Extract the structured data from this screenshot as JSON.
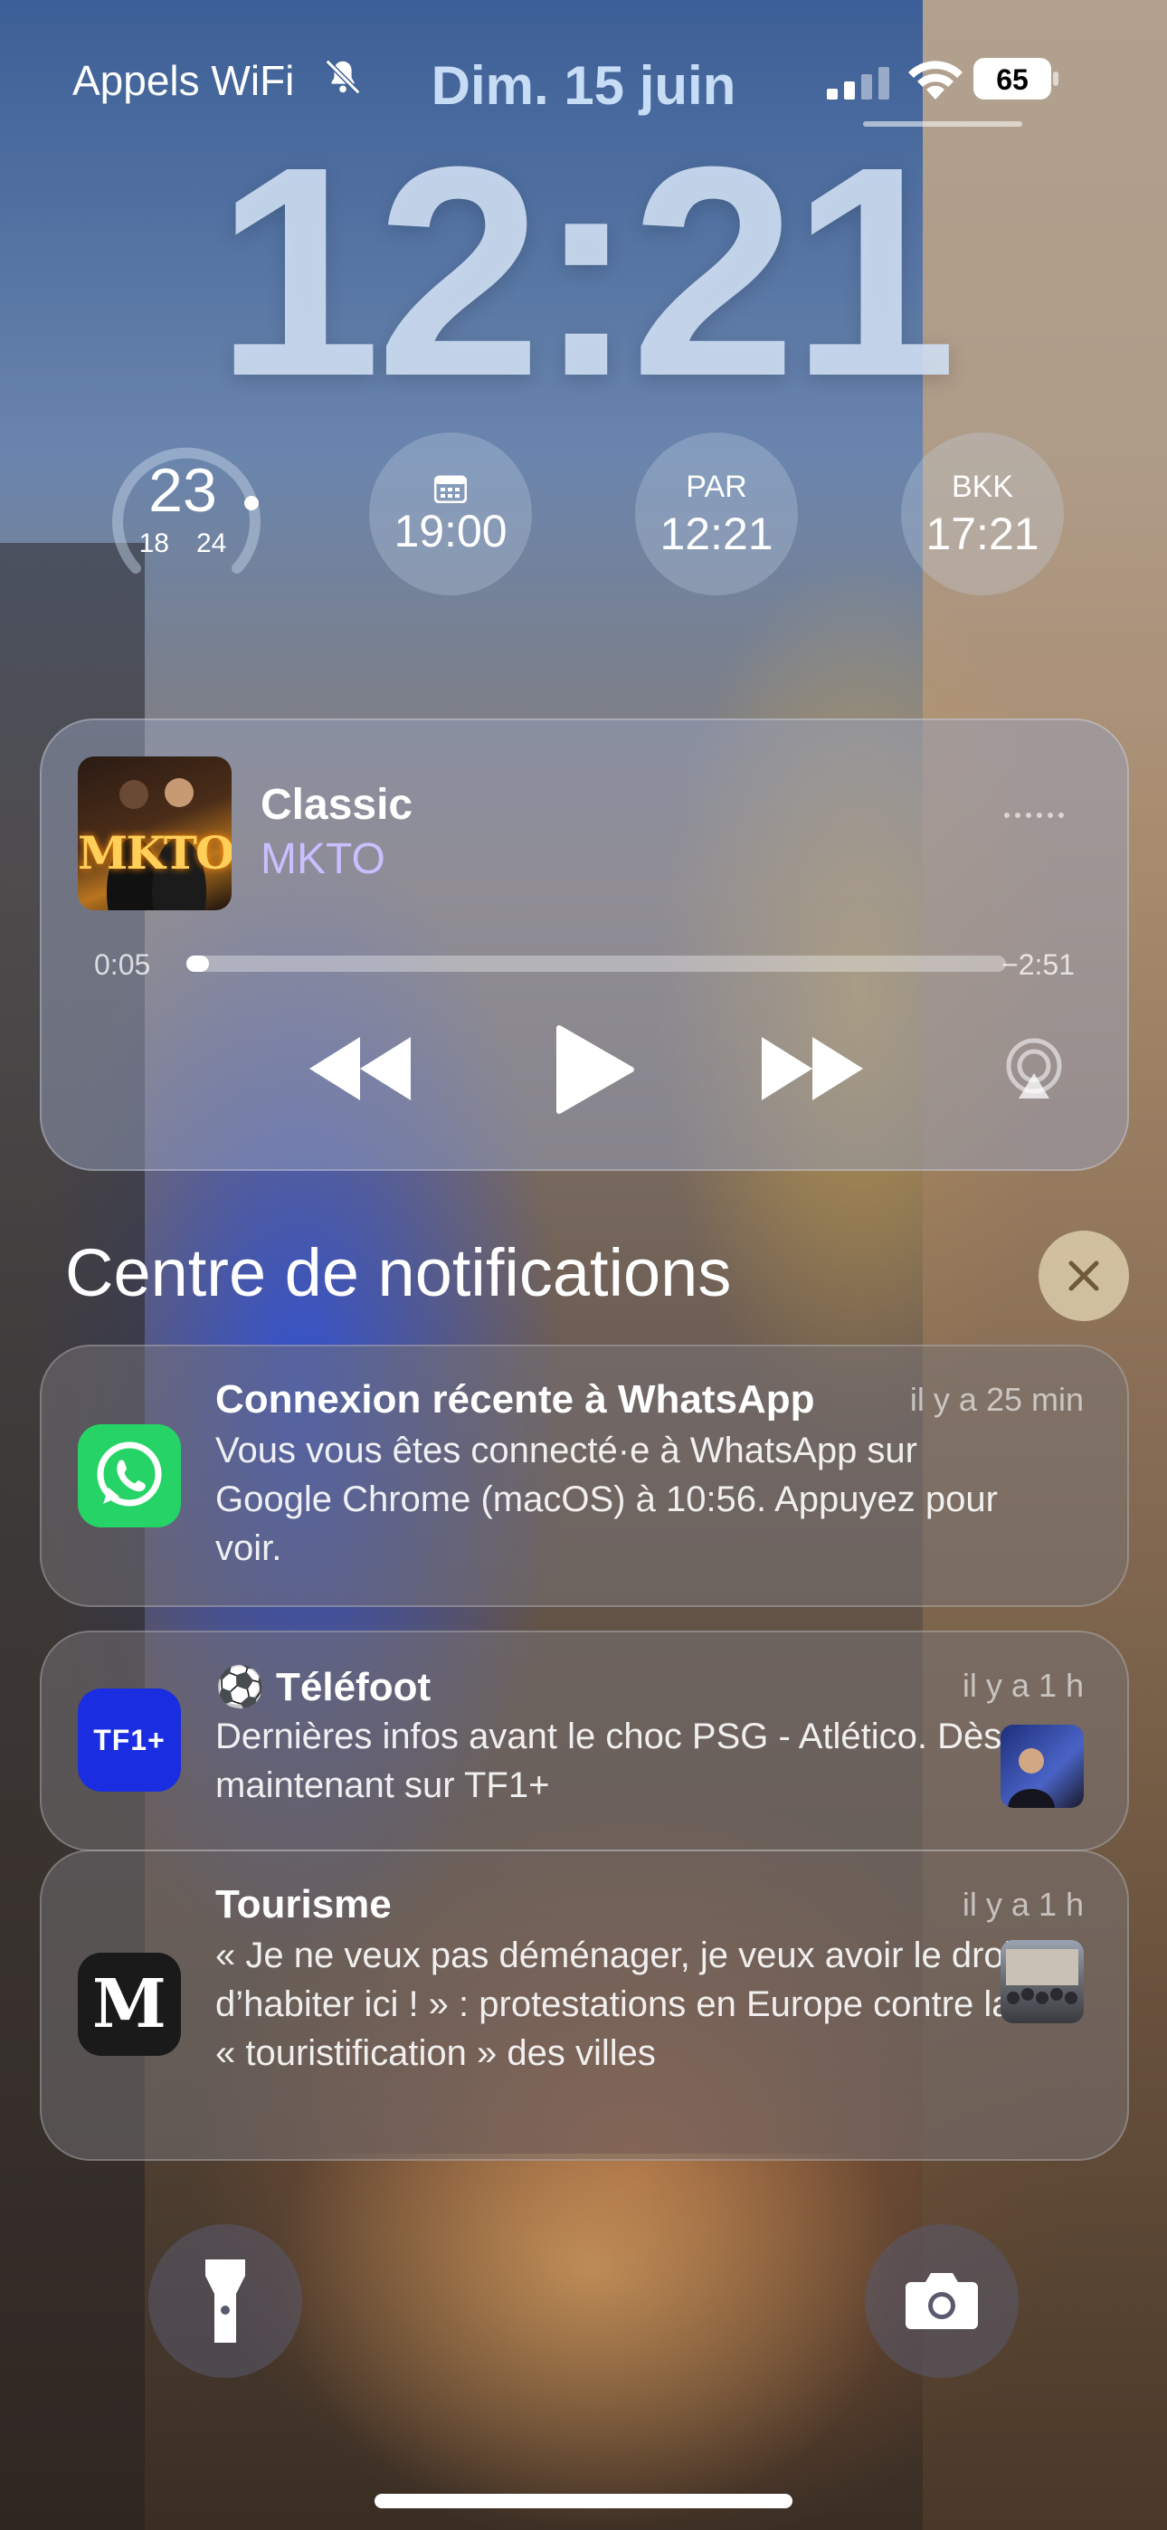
{
  "status_bar": {
    "carrier": "Appels WiFi",
    "silent_icon": "bell-slash-icon",
    "date": "Dim. 15 juin",
    "battery": "65"
  },
  "clock": {
    "time": "12:21"
  },
  "widgets": {
    "weather": {
      "temperature": "23",
      "low": "18",
      "high": "24"
    },
    "calendar": {
      "icon": "calendar-icon",
      "time": "19:00"
    },
    "world_clock_1": {
      "city": "PAR",
      "time": "12:21"
    },
    "world_clock_2": {
      "city": "BKK",
      "time": "17:21"
    }
  },
  "now_playing": {
    "album_art_text": "MKTO",
    "title": "Classic",
    "artist": "MKTO",
    "elapsed": "0:05",
    "remaining": "−2:51",
    "progress": 0.028
  },
  "notification_center": {
    "title": "Centre de notifications"
  },
  "notifications": [
    {
      "app": "WhatsApp",
      "title": "Connexion récente à WhatsApp",
      "time": "il y a 25 min",
      "body": "Vous vous êtes connecté·e à WhatsApp sur Google Chrome (macOS) à 10:56. Appuyez pour voir."
    },
    {
      "app": "TF1+",
      "app_icon_text": "TF1+",
      "title": "⚽ Téléfoot",
      "time": "il y a 1 h",
      "body": "Dernières infos avant le choc PSG - Atlético. Dès maintenant sur TF1+"
    },
    {
      "app": "Le Monde",
      "app_icon_text": "M",
      "title": "Tourisme",
      "time": "il y a 1 h",
      "body": "« Je ne veux pas déménager, je veux avoir le droit d’habiter ici ! » : protestations en Europe contre la « touristification » des villes"
    }
  ],
  "colors": {
    "date": "#c7dcf5",
    "artist": "#c9bfff",
    "whatsapp": "#25d366",
    "tf1": "#1a2de0"
  }
}
